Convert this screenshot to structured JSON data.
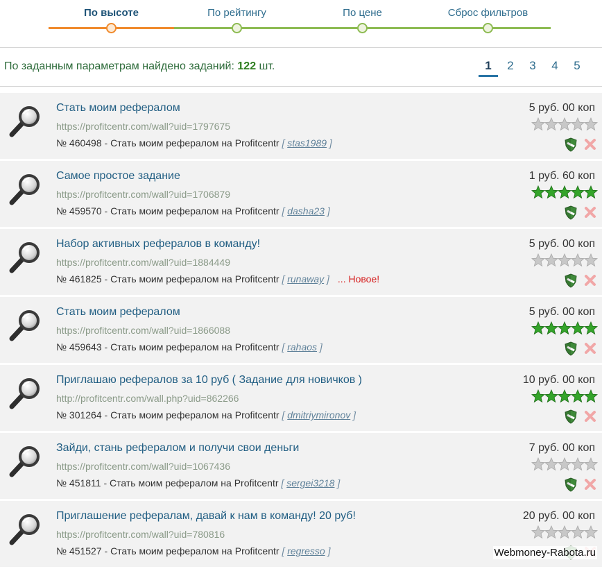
{
  "filters": [
    {
      "label": "По высоте"
    },
    {
      "label": "По рейтингу"
    },
    {
      "label": "По цене"
    },
    {
      "label": "Сброс фильтров"
    }
  ],
  "summary": {
    "text": "По заданным параметрам найдено заданий: ",
    "count": "122",
    "unit": " шт."
  },
  "pager": [
    "1",
    "2",
    "3",
    "4",
    "5"
  ],
  "tasks": [
    {
      "title": "Стать моим рефералом",
      "url": "https://profitcentr.com/wall?uid=1797675",
      "number": "№ 460498",
      "desc": " - Стать моим рефералом на Profitcentr ",
      "user": "stas1989",
      "new": "",
      "price": "5 руб. 00 коп",
      "rating": 0
    },
    {
      "title": "Самое простое задание",
      "url": "https://profitcentr.com/wall?uid=1706879",
      "number": "№ 459570",
      "desc": " - Стать моим рефералом на Profitcentr ",
      "user": "dasha23",
      "new": "",
      "price": "1 руб. 60 коп",
      "rating": 5
    },
    {
      "title": "Набор активных рефералов в команду!",
      "url": "https://profitcentr.com/wall?uid=1884449",
      "number": "№ 461825",
      "desc": " - Стать моим рефералом на Profitcentr ",
      "user": "runaway",
      "new": "... Новое!",
      "price": "5 руб. 00 коп",
      "rating": 0
    },
    {
      "title": "Стать моим рефералом",
      "url": "https://profitcentr.com/wall?uid=1866088",
      "number": "№ 459643",
      "desc": " - Стать моим рефералом на Profitcentr ",
      "user": "rahaos",
      "new": "",
      "price": "5 руб. 00 коп",
      "rating": 5
    },
    {
      "title": "Приглашаю рефералов за 10 руб ( Задание для новичков )",
      "url": "http://profitcentr.com/wall.php?uid=862266",
      "number": "№ 301264",
      "desc": " - Стать моим рефералом на Profitcentr ",
      "user": "dmitriymironov",
      "new": "",
      "price": "10 руб. 00 коп",
      "rating": 5
    },
    {
      "title": "Зайди, стань рефералом и получи свои деньги",
      "url": "https://profitcentr.com/wall?uid=1067436",
      "number": "№ 451811",
      "desc": " - Стать моим рефералом на Profitcentr ",
      "user": "sergei3218",
      "new": "",
      "price": "7 руб. 00 коп",
      "rating": 0
    },
    {
      "title": "Приглашение рефералам, давай к нам в команду! 20 руб!",
      "url": "https://profitcentr.com/wall?uid=780816",
      "number": "№ 451527",
      "desc": " - Стать моим рефералом на Profitcentr ",
      "user": "regresso",
      "new": "",
      "price": "20 руб. 00 коп",
      "rating": 0
    }
  ],
  "watermark": "Webmoney-Rabota.ru",
  "colors": {
    "active_filter": "#f08a2c",
    "filter_bar": "#8dbb52",
    "star_on": "#34a42a",
    "star_off": "#c8c8c8",
    "new_tag": "#d62020"
  }
}
